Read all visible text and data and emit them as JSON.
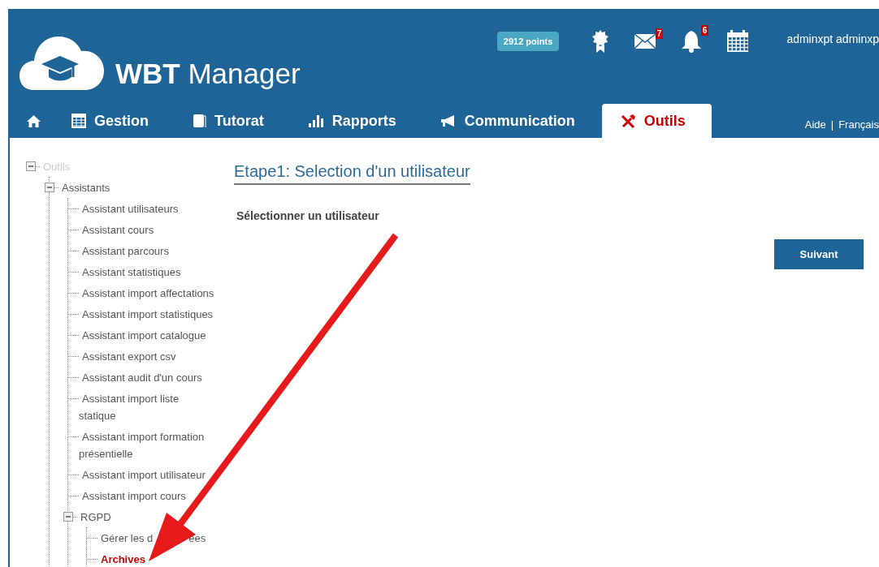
{
  "header": {
    "brand": "**WBT** Manager",
    "points": "2912 points",
    "messages_count": "7",
    "notifications_count": "6",
    "user": "adminxpt adminxp"
  },
  "tabs": [
    {
      "kind": "home",
      "selected": false
    },
    {
      "kind": "text",
      "label": "Gestion",
      "selected": false
    },
    {
      "kind": "text",
      "label": "Tutorat",
      "selected": false
    },
    {
      "kind": "text",
      "label": "Rapports",
      "selected": false
    },
    {
      "kind": "text",
      "label": "Communication",
      "selected": false
    },
    {
      "kind": "text",
      "label": "Outils",
      "selected": true
    }
  ],
  "top_links": [
    "Aide",
    "Français"
  ],
  "top_links_separator": "|",
  "tree": {
    "label": "Outils",
    "disabled": true,
    "expanded": true,
    "children": [
      {
        "label": "Assistants",
        "selected": false,
        "expanded": true,
        "children": [
          {
            "label": "Assistant utilisateurs",
            "selected": false
          },
          {
            "label": "Assistant cours",
            "selected": false
          },
          {
            "label": "Assistant parcours",
            "selected": false
          },
          {
            "label": "Assistant statistiques",
            "selected": false
          },
          {
            "label": "Assistant import affectations",
            "selected": false
          },
          {
            "label": "Assistant import statistiques",
            "selected": false
          },
          {
            "label": "Assistant import catalogue",
            "selected": false
          },
          {
            "label": "Assistant export csv",
            "selected": false
          },
          {
            "label": "Assistant audit d'un cours",
            "selected": false
          },
          {
            "label": "Assistant import liste statique",
            "selected": false
          },
          {
            "label": "Assistant import formation présentielle",
            "selected": false
          },
          {
            "label": "Assistant import utilisateur",
            "selected": false
          },
          {
            "label": "Assistant import cours",
            "selected": false
          },
          {
            "label": "RGPD",
            "selected": false,
            "expanded": true,
            "children": [
              {
                "label": "Gérer les d",
                "label_after_arrow": "ées",
                "selected": false
              },
              {
                "label": "Archives",
                "selected": true
              }
            ]
          }
        ]
      }
    ]
  },
  "content": {
    "heading": "Etape1: Selection d'un utilisateur",
    "label": "Sélectionner un utilisateur",
    "next_button": "Suivant"
  },
  "annotation": {
    "kind": "arrow"
  }
}
